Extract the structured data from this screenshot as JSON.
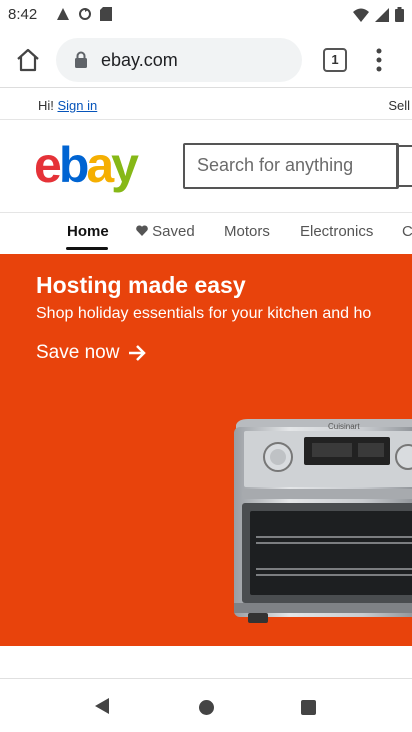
{
  "status_bar": {
    "time": "8:42",
    "left_icons": [
      "alert-icon",
      "sync-icon",
      "sd-card-icon"
    ],
    "right_icons": [
      "wifi-icon",
      "signal-icon",
      "battery-icon"
    ]
  },
  "browser": {
    "url": "ebay.com",
    "tab_count": "1"
  },
  "ebay": {
    "greeting": "Hi! ",
    "sign_in": "Sign in",
    "sell": "Sell",
    "search_placeholder": "Search for anything",
    "nav": [
      {
        "label": "Home",
        "active": true
      },
      {
        "label": "Saved"
      },
      {
        "label": "Motors"
      },
      {
        "label": "Electronics"
      },
      {
        "label": "C"
      }
    ],
    "banner": {
      "title": "Hosting made easy",
      "subtitle": "Shop holiday essentials for your kitchen and ho",
      "cta": "Save now",
      "background": "#e8430c",
      "appliance_brand": "Cuisinart"
    }
  },
  "colors": {
    "ebay_red": "#e53238",
    "ebay_blue": "#0064d2",
    "ebay_yellow": "#f5af02",
    "ebay_green": "#86b817"
  }
}
